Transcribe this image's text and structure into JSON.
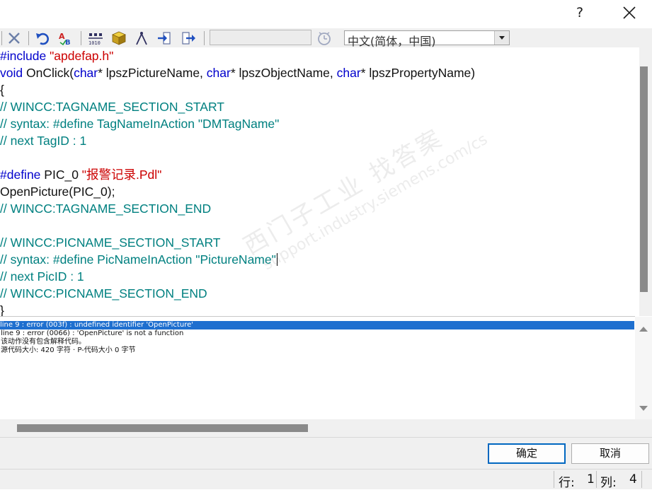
{
  "titlebar": {
    "help_label": "?",
    "close_icon": "close-icon"
  },
  "toolbar": {
    "icons": [
      "cut-icon",
      "undo-icon",
      "spellcheck-icon",
      "compile-icon",
      "box-icon",
      "compass-icon",
      "import-icon",
      "export-icon",
      "clock-icon"
    ],
    "search_value": "",
    "language": "中文(简体，中国)"
  },
  "editor": {
    "lines": [
      [
        {
          "t": "#include ",
          "c": "kw"
        },
        {
          "t": "\"apdefap.h\"",
          "c": "str"
        }
      ],
      [
        {
          "t": "void",
          "c": "kw"
        },
        {
          "t": " OnClick(",
          "c": ""
        },
        {
          "t": "char",
          "c": "kw"
        },
        {
          "t": "* lpszPictureName, ",
          "c": ""
        },
        {
          "t": "char",
          "c": "kw"
        },
        {
          "t": "* lpszObjectName, ",
          "c": ""
        },
        {
          "t": "char",
          "c": "kw"
        },
        {
          "t": "* lpszPropertyName)",
          "c": ""
        }
      ],
      [
        {
          "t": "{",
          "c": ""
        }
      ],
      [
        {
          "t": "// WINCC:TAGNAME_SECTION_START",
          "c": "cmt"
        }
      ],
      [
        {
          "t": "// syntax: #define TagNameInAction \"DMTagName\"",
          "c": "cmt"
        }
      ],
      [
        {
          "t": "// next TagID : 1",
          "c": "cmt"
        }
      ],
      [
        {
          "t": "",
          "c": ""
        }
      ],
      [
        {
          "t": "#define",
          "c": "kw"
        },
        {
          "t": " PIC_0 ",
          "c": ""
        },
        {
          "t": "\"报警记录.Pdl\"",
          "c": "str"
        }
      ],
      [
        {
          "t": "OpenPicture(PIC_0);",
          "c": ""
        }
      ],
      [
        {
          "t": "// WINCC:TAGNAME_SECTION_END",
          "c": "cmt"
        }
      ],
      [
        {
          "t": "",
          "c": ""
        }
      ],
      [
        {
          "t": "// WINCC:PICNAME_SECTION_START",
          "c": "cmt"
        }
      ],
      [
        {
          "t": "// syntax: #define PicNameInAction \"PictureName\"",
          "c": "cmt"
        }
      ],
      [
        {
          "t": "// next PicID : 1",
          "c": "cmt"
        }
      ],
      [
        {
          "t": "// WINCC:PICNAME_SECTION_END",
          "c": "cmt"
        }
      ],
      [
        {
          "t": "}",
          "c": ""
        }
      ]
    ]
  },
  "output": {
    "lines": [
      "line 9 : error (003f) : undefined identifier 'OpenPicture'",
      "line 9 : error (0066) : 'OpenPicture' is not a function",
      "该动作没有包含解释代码。",
      "源代码大小: 420 字符 · P-代码大小 0 字节"
    ],
    "selected_index": 0
  },
  "buttons": {
    "ok_label": "确定",
    "cancel_label": "取消"
  },
  "status": {
    "row_label": "行:",
    "row_value": "1",
    "col_label": "列:",
    "col_value": "4"
  },
  "watermark": {
    "line1": "西门子工业  找答案",
    "line2": "support.industry.siemens.com/cs"
  },
  "colors": {
    "keyword": "#0000cc",
    "string": "#cc0000",
    "comment": "#008080",
    "selection": "#1e6fcf"
  }
}
